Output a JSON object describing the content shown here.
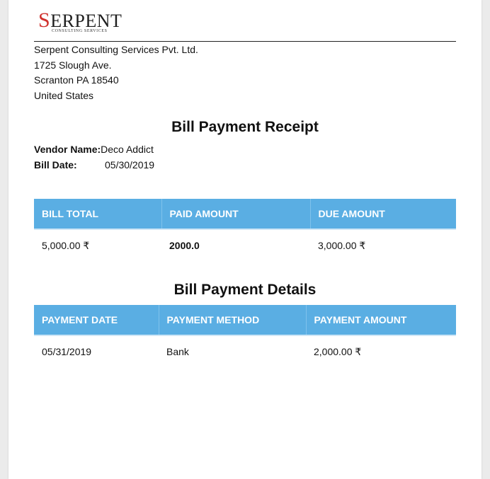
{
  "logo": {
    "word_first": "S",
    "word_rest": "ERPENT",
    "tagline": "CONSULTING SERVICES",
    "accent": "#d0312d"
  },
  "company": {
    "name": "Serpent Consulting Services Pvt. Ltd.",
    "street": "1725 Slough Ave.",
    "city_line": "Scranton PA 18540",
    "country": "United States"
  },
  "receipt": {
    "title": "Bill Payment Receipt",
    "vendor_label": "Vendor Name:",
    "vendor_value": "Deco Addict",
    "date_label": "Bill Date:",
    "date_value": "05/30/2019"
  },
  "summary_table": {
    "headers": [
      "BILL TOTAL",
      "PAID AMOUNT",
      "DUE AMOUNT"
    ],
    "row": [
      "5,000.00 ₹",
      "2000.0",
      "3,000.00 ₹"
    ]
  },
  "details": {
    "title": "Bill Payment Details",
    "headers": [
      "PAYMENT DATE",
      "PAYMENT METHOD",
      "PAYMENT AMOUNT"
    ],
    "rows": [
      [
        "05/31/2019",
        "Bank",
        "2,000.00 ₹"
      ]
    ]
  },
  "colors": {
    "header_blue": "#5aaee3",
    "page_bg": "#ebebeb",
    "sheet_bg": "#ffffff"
  }
}
